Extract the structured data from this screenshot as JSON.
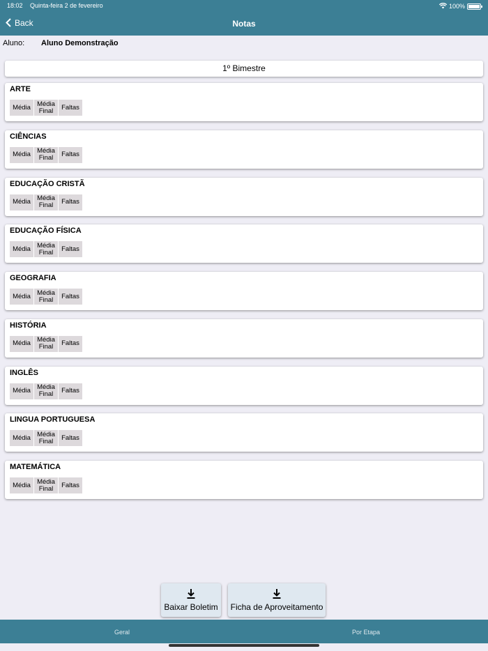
{
  "status": {
    "time": "18:02",
    "date": "Quinta-feira 2 de fevereiro",
    "battery": "100%"
  },
  "nav": {
    "back_label": "Back",
    "title": "Notas"
  },
  "student": {
    "label": "Aluno:",
    "name": "Aluno Demonstração"
  },
  "period": "1º Bimestre",
  "columns": {
    "media": "Média",
    "media_final_1": "Média",
    "media_final_2": "Final",
    "faltas": "Faltas"
  },
  "subjects": [
    {
      "name": "ARTE"
    },
    {
      "name": "CIÊNCIAS"
    },
    {
      "name": "EDUCAÇÃO CRISTÃ"
    },
    {
      "name": "EDUCAÇÃO FÍSICA"
    },
    {
      "name": "GEOGRAFIA"
    },
    {
      "name": "HISTÓRIA"
    },
    {
      "name": "INGLÊS"
    },
    {
      "name": "LINGUA PORTUGUESA"
    },
    {
      "name": "MATEMÁTICA"
    }
  ],
  "actions": {
    "boletim": "Baixar Boletim",
    "ficha": "Ficha de Aproveitamento",
    "icon": "download-icon"
  },
  "tabs": [
    {
      "label": "Geral"
    },
    {
      "label": "Por Etapa"
    }
  ],
  "colors": {
    "bar": "#3c7f95",
    "background": "#eeedf5",
    "column_bg": "#ddd9dc",
    "button_bg": "#dfe8f0"
  }
}
